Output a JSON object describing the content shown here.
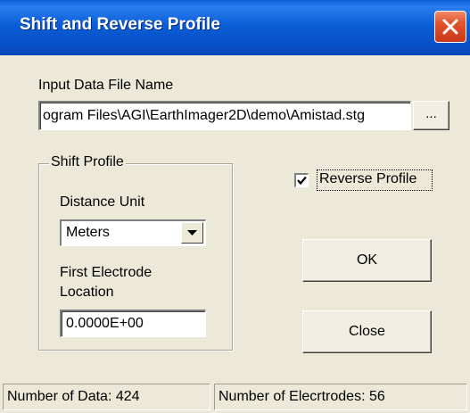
{
  "window": {
    "title": "Shift and Reverse Profile"
  },
  "input_file": {
    "label": "Input Data File Name",
    "value": "ogram Files\\AGI\\EarthImager2D\\demo\\Amistad.stg",
    "browse_label": "..."
  },
  "shift_profile": {
    "legend": "Shift Profile",
    "distance_unit_label": "Distance Unit",
    "distance_unit_value": "Meters",
    "first_electrode_label_line1": "First Electrode",
    "first_electrode_label_line2": "Location",
    "first_electrode_value": "0.0000E+00"
  },
  "reverse_profile": {
    "label": "Reverse Profile",
    "checked": true
  },
  "buttons": {
    "ok": "OK",
    "close": "Close"
  },
  "status": {
    "data_count": "Number of Data: 424",
    "electrode_count": "Number of Elecrtrodes: 56"
  },
  "colors": {
    "titlebar": "#0a5fd8",
    "face": "#ece9d8",
    "close_button": "#e0522a"
  }
}
